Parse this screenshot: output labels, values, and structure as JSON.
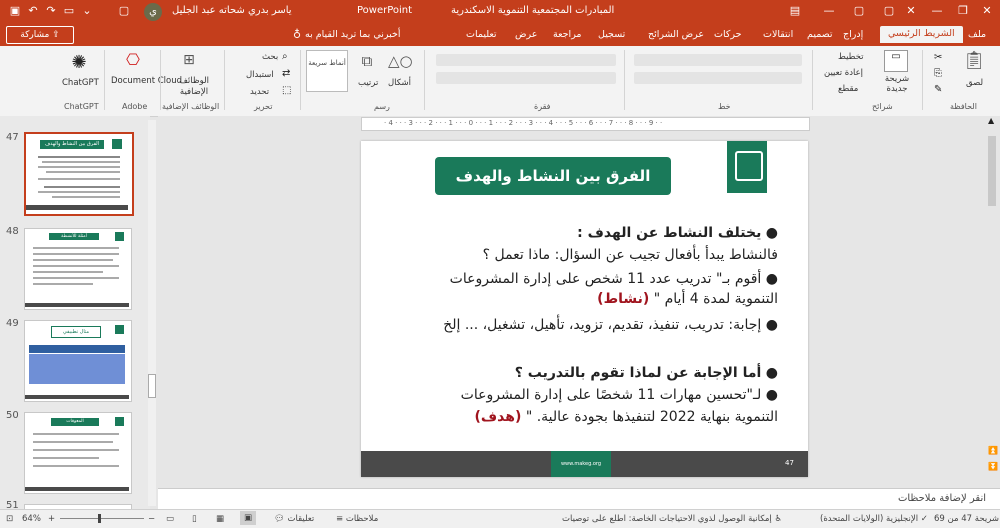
{
  "title_bar": {
    "app": "PowerPoint",
    "doc_title": "المبادرات المجتمعية التنموية الاسكندرية",
    "user": "ياسر بدري شحاته عبد الجليل",
    "avatar_letter": "ي"
  },
  "share_label": "مشاركة",
  "tabs": [
    "ملف",
    "الشريط الرئيسي",
    "إدراج",
    "تصميم",
    "انتقالات",
    "حركات",
    "عرض الشرائح",
    "تسجيل",
    "مراجعة",
    "عرض",
    "تعليمات"
  ],
  "search_hint": "أخبرني بما تريد القيام به",
  "ribbon": {
    "clipboard": {
      "paste": "لصق",
      "group": "الحافظة"
    },
    "slides": {
      "new_slide": "شريحة جديدة",
      "layout": "تخطيط",
      "reset": "إعادة تعيين",
      "section": "مقطع",
      "group": "شرائح"
    },
    "font": {
      "group": "خط"
    },
    "paragraph": {
      "group": "فقرة"
    },
    "drawing": {
      "shapes": "أشكال",
      "arrange": "ترتيب",
      "styles": "أنماط سريعة",
      "group": "رسم"
    },
    "editing": {
      "find": "بحث",
      "replace": "استبدال",
      "select": "تحديد",
      "group": "تحرير"
    },
    "addins": {
      "label": "الوظائف الإضافية",
      "group": "الوظائف الإضافية"
    },
    "adobe": {
      "label": "Document Cloud",
      "group": "Adobe"
    },
    "chatgpt": {
      "label": "ChatGPT",
      "group": "ChatGPT"
    }
  },
  "thumbnails": [
    {
      "num": "47",
      "title": "الفرق بين النشاط والهدف"
    },
    {
      "num": "48",
      "title": "أمثلة للأنشطة"
    },
    {
      "num": "49",
      "title": "مثال تطبيقي"
    },
    {
      "num": "50",
      "title": "المعوقات"
    },
    {
      "num": "51",
      "title": ""
    }
  ],
  "slide": {
    "title": "الفرق بين النشاط والهدف",
    "lines": [
      {
        "text": "يختلف النشاط عن الهدف :",
        "bullet": true,
        "bold": true
      },
      {
        "text": "فالنشاط يبدأ بأفعال تجيب عن السؤال: ماذا تعمل ؟",
        "bullet": false
      },
      {
        "text": "أقوم بـ\" تدريب عدد 11 شخص على إدارة المشروعات",
        "bullet": true
      },
      {
        "text": "التنموية لمدة 4 أيام \"",
        "bullet": false,
        "red": "(نشاط)"
      },
      {
        "text": "إجابة: تدريب، تنفيذ، تقديم، تزويد، تأهيل، تشغيل، ... إلخ",
        "bullet": true
      },
      {
        "text": "أما الإجابة عن لماذا تقوم بالتدريب ؟",
        "bullet": true,
        "bold": true
      },
      {
        "text": "لـ\"تحسين مهارات 11 شخصًا على إدارة المشروعات",
        "bullet": true
      },
      {
        "text": "التنموية بنهاية 2022 لتنفيذها بجودة عالية. \"",
        "bullet": false,
        "red": "(هدف)"
      }
    ],
    "footer_site": "www.makeg.org",
    "footer_page": "47"
  },
  "notes_placeholder": "انقر لإضافة ملاحظات",
  "status": {
    "slide_count": "شريحة 47 من 69",
    "language": "الإنجليزية (الولايات المتحدة)",
    "accessibility": "إمكانية الوصول لذوي الاحتياجات الخاصة: اطلع على توصيات",
    "notes": "ملاحظات",
    "comments": "تعليقات",
    "zoom": "64%"
  },
  "colors": {
    "accent": "#c43e1c",
    "slide_green": "#1a7a5a",
    "footer_gray": "#4a4a4a"
  }
}
